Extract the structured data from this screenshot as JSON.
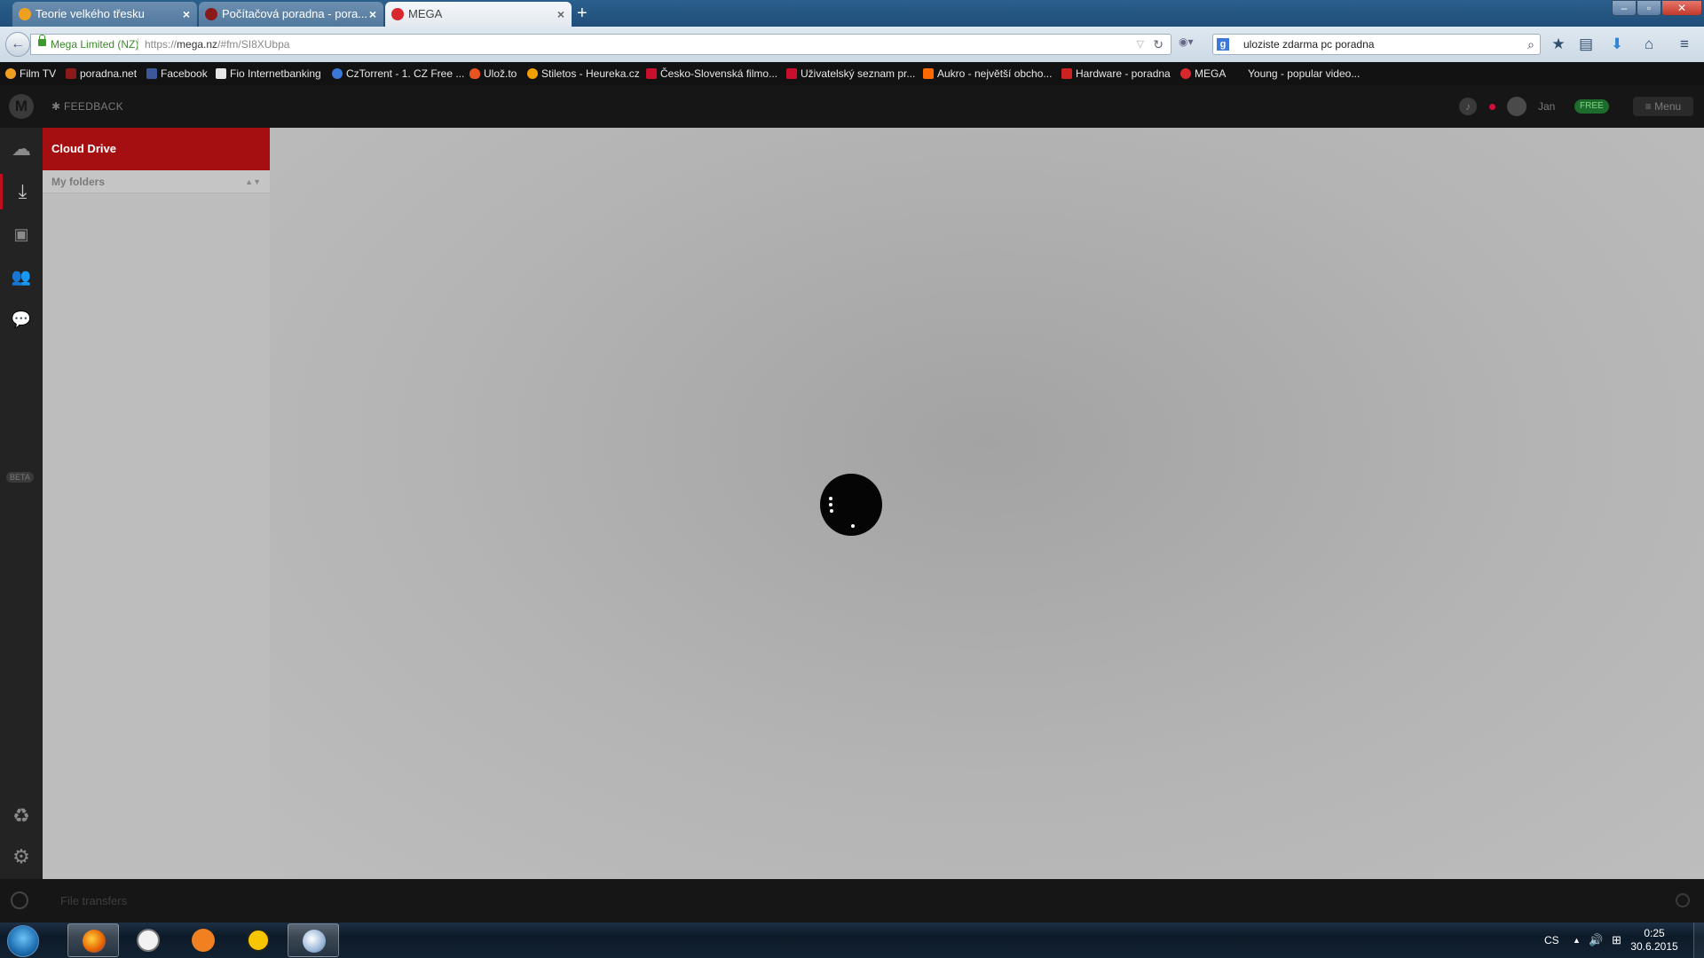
{
  "browser": {
    "tabs": [
      {
        "label": "Teorie velkého třesku",
        "favicon_color": "#f0a020",
        "active": false
      },
      {
        "label": "Počítačová poradna - pora...",
        "favicon_color": "#8a1a1a",
        "active": false
      },
      {
        "label": "MEGA",
        "favicon_color": "#d9272e",
        "active": true
      }
    ],
    "close_glyph": "×",
    "new_tab_glyph": "+",
    "window_buttons": {
      "minimize": "–",
      "maximize": "▫",
      "close": "✕"
    },
    "back_glyph": "←",
    "url": {
      "identity": "Mega Limited (NZ)",
      "prefix": "https://",
      "domain": "mega.nz",
      "path": "/#fm/SI8XUbpa"
    },
    "reload_glyph": "↻",
    "url_star_glyph": "▽",
    "search_engine_glyph": "◉▾",
    "search": {
      "engine_letter": "g",
      "value": "uloziste zdarma pc poradna"
    },
    "search_glyph": "⌕",
    "nav_icons": {
      "bookmark": "★",
      "library": "▤",
      "download": "⬇",
      "home": "⌂",
      "menu": "≡"
    },
    "bookmarks": [
      {
        "label": "Film TV",
        "color": "#f0a020"
      },
      {
        "label": "poradna.net",
        "color": "#8a1a1a"
      },
      {
        "label": "Facebook",
        "color": "#3b5998"
      },
      {
        "label": "Fio Internetbanking",
        "color": "#e6e6e6"
      },
      {
        "label": "CzTorrent - 1. CZ Free ...",
        "color": "#3b78d8"
      },
      {
        "label": "Ulož.to",
        "color": "#e8531e"
      },
      {
        "label": "Stiletos - Heureka.cz",
        "color": "#f2a000"
      },
      {
        "label": "Česko-Slovenská filmo...",
        "color": "#c8102e"
      },
      {
        "label": "Uživatelský seznam pr...",
        "color": "#c8102e"
      },
      {
        "label": "Aukro - největší obcho...",
        "color": "#ff6a00"
      },
      {
        "label": "Hardware - poradna",
        "color": "#cc2222"
      },
      {
        "label": "MEGA",
        "color": "#d9272e"
      },
      {
        "label": "Young - popular video...",
        "color": "#121212"
      }
    ]
  },
  "mega": {
    "logo_letter": "M",
    "feedback_label": "FEEDBACK",
    "feedback_glyph": "✱",
    "bell_glyph": "♪",
    "username": "Jan",
    "plan_badge": "FREE",
    "menu_label": "Menu",
    "menu_glyph": "≡",
    "rail_icons": {
      "cloud": "☁",
      "inbox": "⤓",
      "shared": "▣",
      "contacts": "👥",
      "chat": "💬",
      "rubbish": "♻",
      "settings": "⚙"
    },
    "beta_tag": "BETA",
    "tree": {
      "cloud_drive_label": "Cloud Drive",
      "my_folders_label": "My folders",
      "sort_glyph": "▲▼"
    },
    "transfers_label": "File transfers"
  },
  "taskbar": {
    "apps": [
      {
        "name": "firefox",
        "color": "#e66000",
        "running": true
      },
      {
        "name": "app2",
        "color": "#ffffff",
        "running": false
      },
      {
        "name": "app3",
        "color": "#f08020",
        "running": false
      },
      {
        "name": "app4",
        "color": "#f7c600",
        "running": false
      },
      {
        "name": "paint",
        "color": "#9ab8d8",
        "running": true
      }
    ],
    "language": "CS",
    "tray_glyphs": {
      "chevron": "▲",
      "volume": "🔊",
      "network": "⊞"
    },
    "time": "0:25",
    "date": "30.6.2015"
  }
}
